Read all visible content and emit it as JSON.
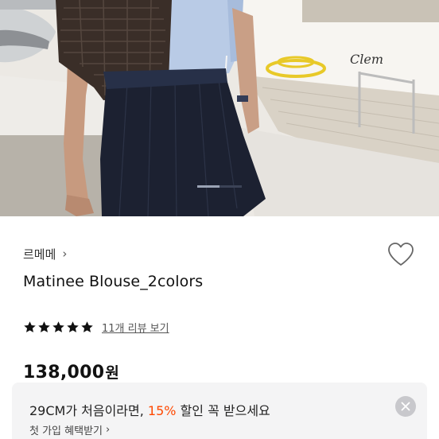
{
  "hero": {
    "boat_name": "Clem"
  },
  "product": {
    "brand": "르메메",
    "brand_chevron": "›",
    "title": "Matinee Blouse_2colors",
    "rating_stars": 5,
    "review_link": "11개 리뷰 보기",
    "price": "138,000",
    "price_unit": "원",
    "wishlist_icon": "heart-outline-icon"
  },
  "promo": {
    "text_before": "29CM가 처음이라면, ",
    "discount": "15%",
    "text_after": " 할인 꼭 받으세요",
    "sub_label": "첫 가입 혜택받기",
    "sub_chevron": "›",
    "close_icon": "close-icon"
  },
  "colors": {
    "accent": "#ff4800",
    "banner_bg": "#f4f4f5"
  }
}
